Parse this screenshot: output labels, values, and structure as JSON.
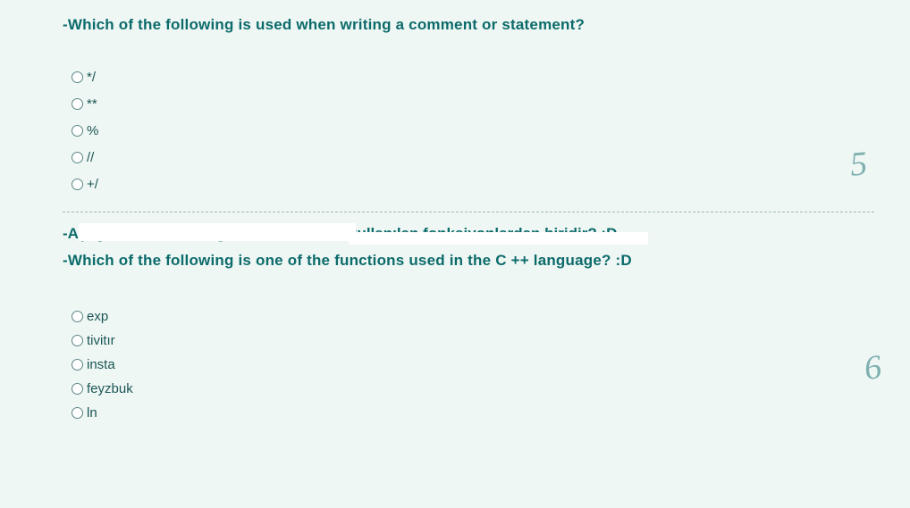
{
  "question1": {
    "text": "-Which of the following is used when writing a comment or statement?",
    "options": [
      "*/",
      "**",
      "%",
      "//",
      "+/"
    ]
  },
  "obscured": {
    "partial_left": "-Aşağıdakilerden hangisi C++ dilinde",
    "partial_right": "kullanılan fonksiyonlardan biridir? :D"
  },
  "question2": {
    "text": "-Which of the following is one of the functions used in the C ++ language? :D",
    "options": [
      "exp",
      "tivitır",
      "insta",
      "feyzbuk",
      "ln"
    ]
  },
  "margin": {
    "mark1": "5",
    "mark2": "6"
  }
}
